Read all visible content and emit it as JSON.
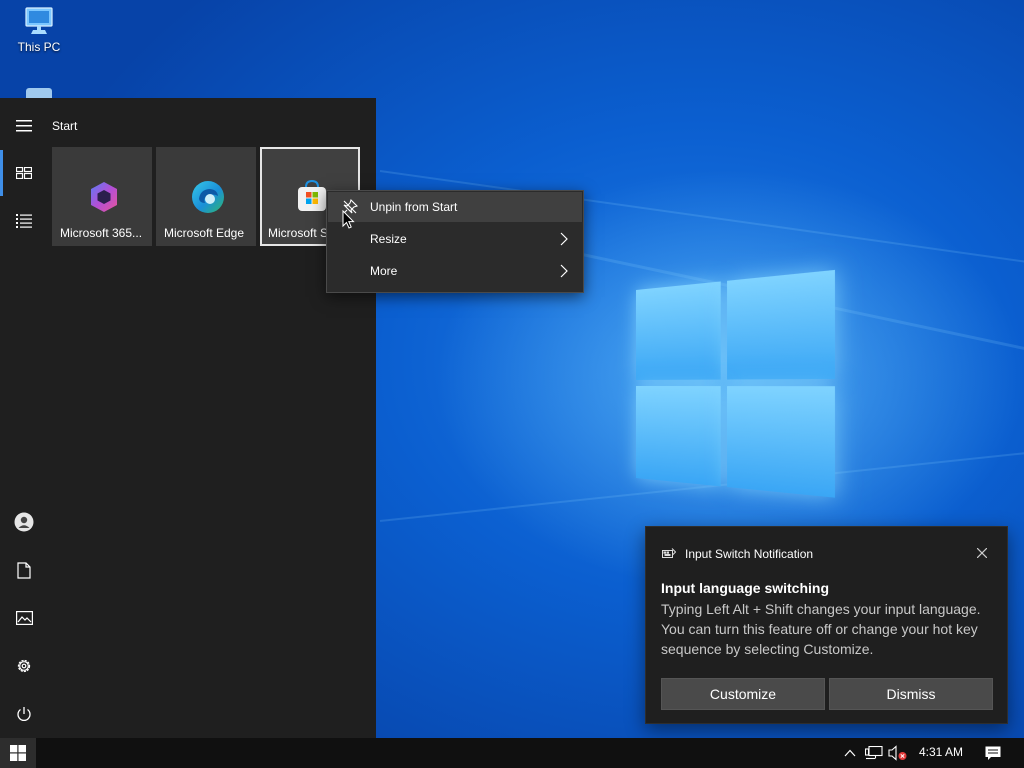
{
  "desktop": {
    "icons": [
      {
        "label": "This PC",
        "icon": "this-pc-icon"
      }
    ]
  },
  "start_menu": {
    "title": "Start",
    "rail": [
      {
        "icon": "hamburger-menu-icon"
      },
      {
        "icon": "tiles-icon",
        "active": true
      },
      {
        "icon": "all-apps-list-icon"
      },
      {
        "icon": "user-account-icon"
      },
      {
        "icon": "documents-icon"
      },
      {
        "icon": "pictures-icon"
      },
      {
        "icon": "settings-gear-icon"
      },
      {
        "icon": "power-icon"
      }
    ],
    "tiles": [
      {
        "label": "Microsoft 365...",
        "icon": "microsoft-365-icon"
      },
      {
        "label": "Microsoft Edge",
        "icon": "edge-icon"
      },
      {
        "label": "Microsoft S",
        "icon": "microsoft-store-icon",
        "selected": true
      }
    ]
  },
  "context_menu": {
    "items": [
      {
        "label": "Unpin from Start",
        "icon": "unpin-icon",
        "hover": true
      },
      {
        "label": "Resize",
        "submenu": true
      },
      {
        "label": "More",
        "submenu": true
      }
    ]
  },
  "notification": {
    "app_name": "Input Switch Notification",
    "heading": "Input language switching",
    "body": "Typing Left Alt + Shift changes your input language. You can turn this feature off or change your hot key sequence by selecting Customize.",
    "buttons": {
      "customize": "Customize",
      "dismiss": "Dismiss"
    }
  },
  "taskbar": {
    "clock": "4:31 AM",
    "tray_icons": [
      "show-hidden-icons-chevron-icon",
      "network-icon",
      "volume-muted-icon",
      "action-center-icon"
    ]
  },
  "colors": {
    "accent": "#3f8fe8",
    "start_bg": "#1f1f1f",
    "tile_bg": "#3a3a3a",
    "taskbar_bg": "#101010"
  }
}
